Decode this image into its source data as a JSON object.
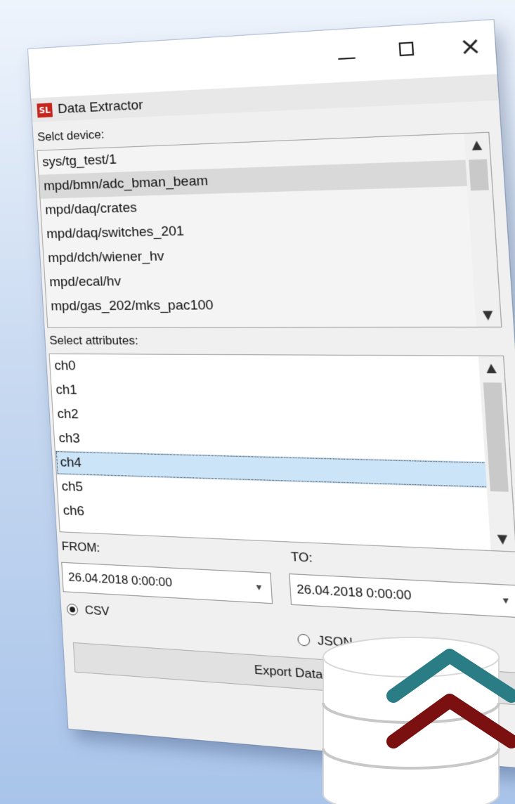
{
  "window": {
    "title": "Data Extractor",
    "logo_text": "SL",
    "controls": {
      "minimize": "minimize-icon",
      "maximize": "maximize-icon",
      "close": "×"
    }
  },
  "device_section": {
    "label": "Selct device:",
    "items": [
      "sys/tg_test/1",
      "mpd/bmn/adc_bman_beam",
      "mpd/daq/crates",
      "mpd/daq/switches_201",
      "mpd/dch/wiener_hv",
      "mpd/ecal/hv",
      "mpd/gas_202/mks_pac100"
    ],
    "selected_index": 1
  },
  "attribute_section": {
    "label": "Select attributes:",
    "items": [
      "ch0",
      "ch1",
      "ch2",
      "ch3",
      "ch4",
      "ch5",
      "ch6"
    ],
    "selected_index": 4
  },
  "range": {
    "from_label": "FROM:",
    "to_label": "TO:",
    "from_value": "26.04.2018 0:00:00",
    "to_value": "26.04.2018 0:00:00"
  },
  "format": {
    "csv_label": "CSV",
    "json_label": "JSON",
    "selected": "CSV"
  },
  "export_button": "Export Data",
  "icons": {
    "scroll_up": "▲",
    "scroll_down": "▼",
    "dropdown": "chevron-down-icon",
    "database": "database-icon"
  },
  "colors": {
    "logo": "#c6261e",
    "db_arrow_top": "#2a7d85",
    "db_arrow_bottom": "#7a1010"
  }
}
